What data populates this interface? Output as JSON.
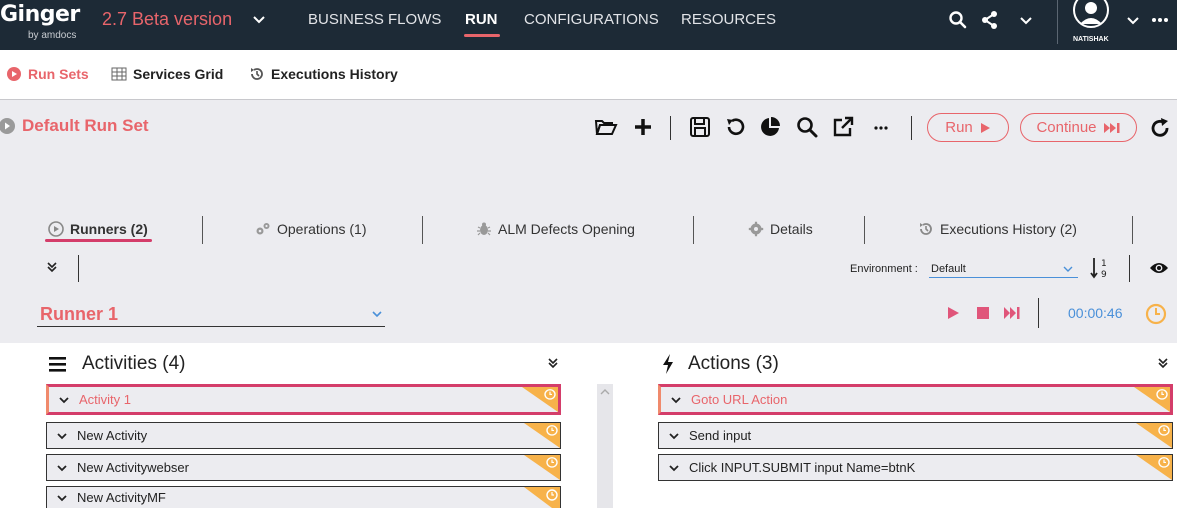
{
  "app": {
    "logo": "Ginger",
    "logo_sub": "by amdocs",
    "version": "2.7 Beta version",
    "user": "NATISHAK"
  },
  "nav": {
    "items": [
      {
        "label": "BUSINESS FLOWS"
      },
      {
        "label": "RUN"
      },
      {
        "label": "CONFIGURATIONS"
      },
      {
        "label": "RESOURCES"
      }
    ],
    "active": "RUN"
  },
  "subnav": {
    "items": [
      {
        "label": "Run Sets"
      },
      {
        "label": "Services Grid"
      },
      {
        "label": "Executions History"
      }
    ]
  },
  "runset": {
    "title": "Default Run Set",
    "run_label": "Run",
    "continue_label": "Continue"
  },
  "tabs": [
    {
      "label": "Runners (2)"
    },
    {
      "label": "Operations (1)"
    },
    {
      "label": "ALM Defects Opening"
    },
    {
      "label": "Details"
    },
    {
      "label": "Executions History (2)"
    }
  ],
  "environment": {
    "label": "Environment :",
    "value": "Default"
  },
  "runner": {
    "name": "Runner 1",
    "elapsed": "00:00:46"
  },
  "activities": {
    "title": "Activities (4)",
    "items": [
      {
        "label": "Activity 1"
      },
      {
        "label": "New Activity"
      },
      {
        "label": "New Activitywebser"
      },
      {
        "label": "New ActivityMF"
      }
    ]
  },
  "actions": {
    "title": "Actions (3)",
    "items": [
      {
        "label": "Goto URL Action"
      },
      {
        "label": "Send input"
      },
      {
        "label": "Click INPUT.SUBMIT input Name=btnK"
      }
    ]
  },
  "colors": {
    "accent": "#e8656b",
    "topbar": "#1d2a36",
    "link": "#4a90d9",
    "flag": "#f7b24a"
  }
}
